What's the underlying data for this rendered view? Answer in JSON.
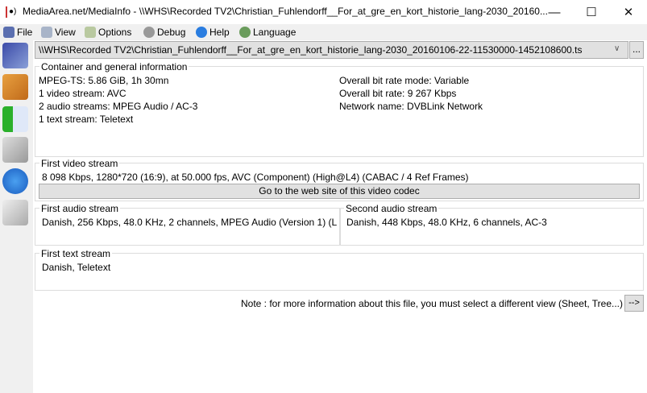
{
  "window": {
    "title": "MediaArea.net/MediaInfo - \\\\WHS\\Recorded TV2\\Christian_Fuhlendorff__For_at_gre_en_kort_historie_lang-2030_20160...",
    "minimize": "—",
    "maximize": "☐",
    "close": "✕"
  },
  "menu": [
    {
      "label": "File",
      "icon": "file-icon"
    },
    {
      "label": "View",
      "icon": "view-icon"
    },
    {
      "label": "Options",
      "icon": "options-icon"
    },
    {
      "label": "Debug",
      "icon": "debug-icon"
    },
    {
      "label": "Help",
      "icon": "help-icon"
    },
    {
      "label": "Language",
      "icon": "language-icon"
    }
  ],
  "file_path": "\\\\WHS\\Recorded TV2\\Christian_Fuhlendorff__For_at_gre_en_kort_historie_lang-2030_20160106-22-11530000-1452108600.ts",
  "browse_label": "...",
  "general": {
    "legend": "Container and general information",
    "left": [
      "MPEG-TS: 5.86 GiB, 1h 30mn",
      "1 video stream: AVC",
      "2 audio streams: MPEG Audio / AC-3",
      "1 text stream: Teletext"
    ],
    "right": [
      "Overall bit rate mode: Variable",
      "Overall bit rate: 9 267 Kbps",
      "Network name: DVBLink Network"
    ]
  },
  "video": {
    "legend": "First video stream",
    "text": "8 098 Kbps, 1280*720 (16:9), at 50.000 fps, AVC (Component) (High@L4) (CABAC / 4 Ref Frames)",
    "button": "Go to the web site of this video codec"
  },
  "audio1": {
    "legend": "First audio stream",
    "text": "Danish, 256 Kbps, 48.0 KHz, 2 channels, MPEG Audio (Version 1) (L"
  },
  "audio2": {
    "legend": "Second audio stream",
    "text": "Danish, 448 Kbps, 48.0 KHz, 6 channels, AC-3"
  },
  "textstream": {
    "legend": "First text stream",
    "text": "Danish, Teletext"
  },
  "note": "Note : for more information about this file, you must select a different view (Sheet, Tree...)",
  "next_label": "-->"
}
